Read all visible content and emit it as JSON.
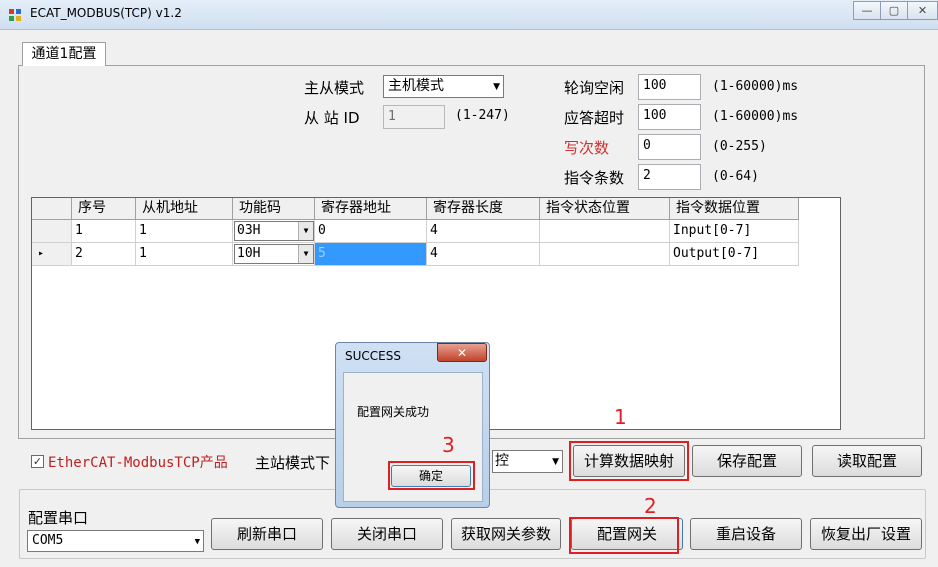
{
  "window": {
    "title": "ECAT_MODBUS(TCP) v1.2",
    "minimize": "—",
    "maximize": "▢",
    "close": "✕"
  },
  "tab": {
    "label": "通道1配置"
  },
  "settings": {
    "mode_label": "主从模式",
    "mode_value": "主机模式",
    "slave_id_label": "从 站 ID",
    "slave_id_value": "1",
    "slave_id_range": "(1-247)",
    "poll_idle_label": "轮询空闲",
    "poll_idle_value": "100",
    "poll_idle_range": "(1-60000)ms",
    "timeout_label": "应答超时",
    "timeout_value": "100",
    "timeout_range": "(1-60000)ms",
    "write_count_label": "写次数",
    "write_count_value": "0",
    "write_count_range": "(0-255)",
    "cmd_count_label": "指令条数",
    "cmd_count_value": "2",
    "cmd_count_range": "(0-64)"
  },
  "grid": {
    "headers": [
      "序号",
      "从机地址",
      "功能码",
      "寄存器地址",
      "寄存器长度",
      "指令状态位置",
      "指令数据位置"
    ],
    "rows": [
      {
        "index": "1",
        "slave_addr": "1",
        "func": "03H",
        "reg_addr": "0",
        "reg_len": "4",
        "status_pos": "",
        "data_pos": "Input[0-7]"
      },
      {
        "index": "2",
        "slave_addr": "1",
        "func": "10H",
        "reg_addr": "5",
        "reg_len": "4",
        "status_pos": "",
        "data_pos": "Output[0-7]"
      }
    ],
    "current_row_marker": "▸"
  },
  "options": {
    "checkbox_label": "EtherCAT-ModbusTCP产品",
    "checkbox_mark": "✓",
    "master_mode_label": "主站模式下",
    "control_value": "控"
  },
  "buttons": {
    "calc_mapping": "计算数据映射",
    "save_config": "保存配置",
    "read_config": "读取配置",
    "refresh_port": "刷新串口",
    "close_port": "关闭串口",
    "get_params": "获取网关参数",
    "config_gateway": "配置网关",
    "restart": "重启设备",
    "factory_reset": "恢复出厂设置"
  },
  "serial": {
    "label": "配置串口",
    "port_value": "COM5"
  },
  "dialog": {
    "title": "SUCCESS",
    "message": "配置网关成功",
    "ok": "确定",
    "close": "✕"
  },
  "annotations": {
    "step1": "1",
    "step2": "2",
    "step3": "3"
  },
  "colors": {
    "annotation_red": "#e02020",
    "selection_blue": "#3399ff",
    "write_label_red": "#d03030",
    "checkbox_text_red": "#c02020"
  }
}
